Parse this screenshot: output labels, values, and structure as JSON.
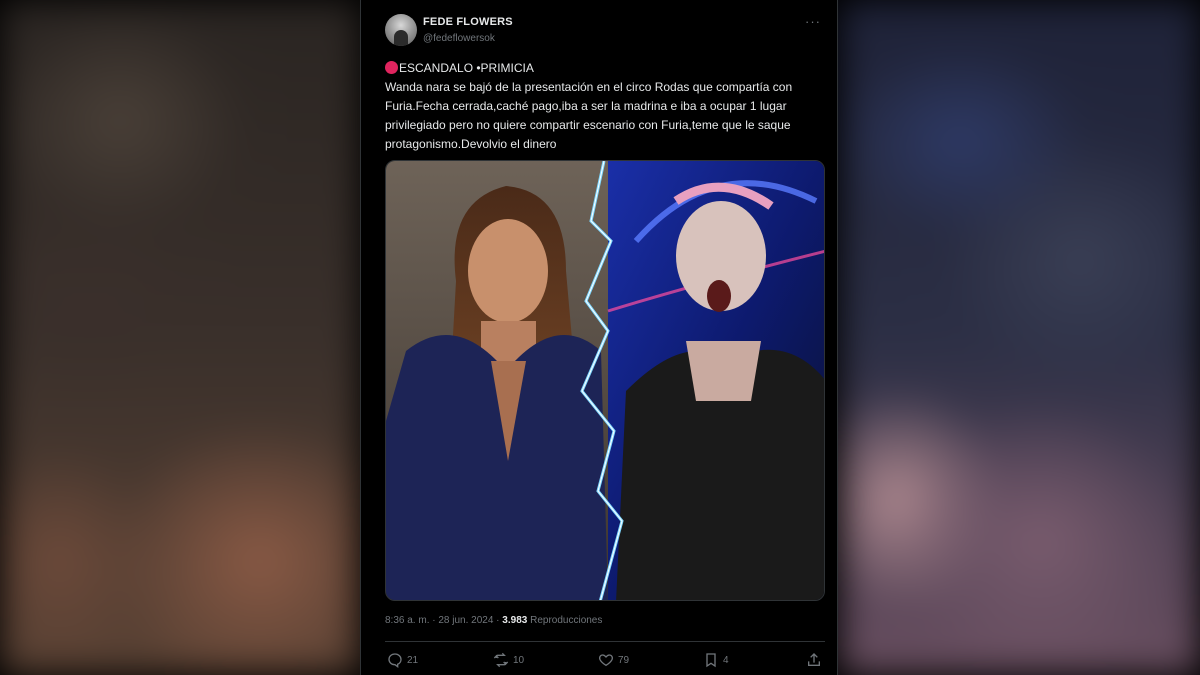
{
  "tweet": {
    "author": {
      "display_name": "FEDE FLOWERS",
      "handle": "@fedeflowersok",
      "avatar_icon": "avatar-icon"
    },
    "more_icon": "more-icon",
    "badge_icon": "red-circle-icon",
    "text_line1": "ESCANDALO •PRIMICIA",
    "text_body": "Wanda nara se bajó de la presentación en el circo Rodas que compartía con Furia.Fecha cerrada,caché pago,iba a ser la madrina e iba a ocupar 1 lugar privilegiado pero no quiere compartir escenario con Furia,teme que le saque protagonismo.Devolvio el dinero",
    "media_icon": "photo-collage",
    "timestamp": "8:36 a. m. · 28 jun. 2024 · ",
    "views_count": "3.983",
    "views_label": " Reproducciones",
    "actions": {
      "reply_count": "21",
      "repost_count": "10",
      "like_count": "79",
      "bookmark_count": "4"
    }
  },
  "colors": {
    "text_primary": "#e7e9ea",
    "text_secondary": "#71767b",
    "divider": "#2f3336",
    "badge_red": "#e0245e",
    "background": "#000000"
  }
}
